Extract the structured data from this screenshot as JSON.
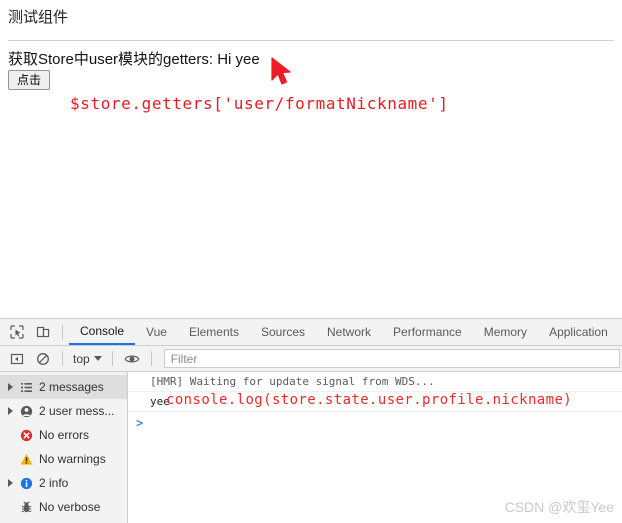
{
  "page": {
    "title": "测试组件",
    "getters_line": "获取Store中user模块的getters: Hi yee",
    "button_label": "点击",
    "code_annotation": "$store.getters['user/formatNickname']"
  },
  "devtools": {
    "icons": {
      "inspect": "inspect-element-icon",
      "device": "device-toolbar-icon",
      "sidebar_toggle": "sidebar-toggle-icon",
      "clear": "clear-console-icon",
      "eye": "eye-icon"
    },
    "tabs": [
      {
        "label": "Console",
        "active": true
      },
      {
        "label": "Vue",
        "active": false
      },
      {
        "label": "Elements",
        "active": false
      },
      {
        "label": "Sources",
        "active": false
      },
      {
        "label": "Network",
        "active": false
      },
      {
        "label": "Performance",
        "active": false
      },
      {
        "label": "Memory",
        "active": false
      },
      {
        "label": "Application",
        "active": false
      }
    ],
    "toolbar": {
      "context": "top",
      "filter_placeholder": "Filter",
      "filter_value": ""
    },
    "sidebar": [
      {
        "label": "2 messages",
        "icon": "list-icon",
        "expandable": true,
        "selected": true
      },
      {
        "label": "2 user mess...",
        "icon": "user-icon",
        "expandable": true,
        "selected": false
      },
      {
        "label": "No errors",
        "icon": "error-icon",
        "expandable": false,
        "selected": false
      },
      {
        "label": "No warnings",
        "icon": "warning-icon",
        "expandable": false,
        "selected": false
      },
      {
        "label": "2 info",
        "icon": "info-icon",
        "expandable": true,
        "selected": false
      },
      {
        "label": "No verbose",
        "icon": "bug-icon",
        "expandable": false,
        "selected": false
      }
    ],
    "console": {
      "line1": "[HMR] Waiting for update signal from WDS...",
      "line2": "yee",
      "annotation": "console.log(store.state.user.profile.nickname)",
      "prompt": ">"
    }
  },
  "watermark": "CSDN @欢玺Yee",
  "colors": {
    "accent": "#1a73e8",
    "annotation_red": "#ef2a2a",
    "code_red": "#e81b23",
    "error": "#e32b2b",
    "warning": "#f5b300",
    "info": "#1a73e8"
  }
}
